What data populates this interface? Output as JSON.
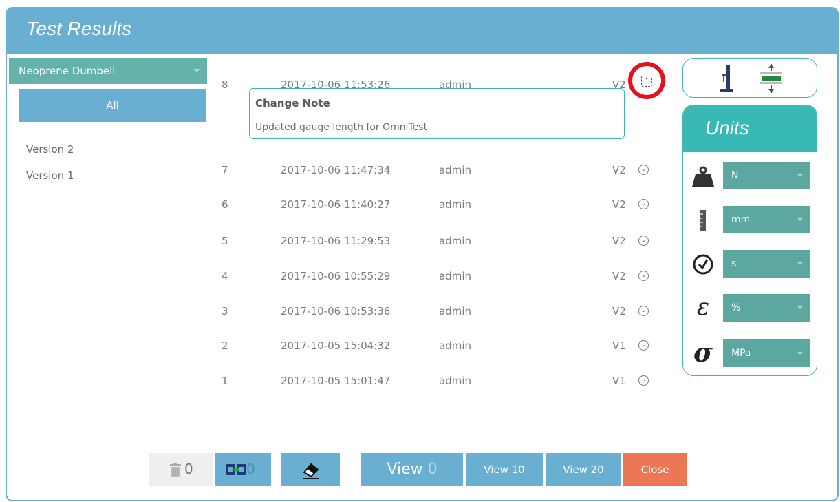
{
  "window": {
    "title": "Test Results"
  },
  "left_panel": {
    "dataset": "Neoprene Dumbell",
    "all_label": "All",
    "versions": [
      "Version 2",
      "Version 1"
    ]
  },
  "results": [
    {
      "num": "8",
      "date": "2017-10-06 11:53:26",
      "user": "admin",
      "version": "V2",
      "expanded": true
    },
    {
      "num": "7",
      "date": "2017-10-06 11:47:34",
      "user": "admin",
      "version": "V2"
    },
    {
      "num": "6",
      "date": "2017-10-06 11:40:27",
      "user": "admin",
      "version": "V2"
    },
    {
      "num": "5",
      "date": "2017-10-06 11:29:53",
      "user": "admin",
      "version": "V2"
    },
    {
      "num": "4",
      "date": "2017-10-06 10:55:29",
      "user": "admin",
      "version": "V2"
    },
    {
      "num": "3",
      "date": "2017-10-06 10:53:36",
      "user": "admin",
      "version": "V2"
    },
    {
      "num": "2",
      "date": "2017-10-05 15:04:32",
      "user": "admin",
      "version": "V1"
    },
    {
      "num": "1",
      "date": "2017-10-05 15:01:47",
      "user": "admin",
      "version": "V1"
    }
  ],
  "change_note": {
    "heading": "Change Note",
    "text": "Updated gauge length for OmniTest"
  },
  "units": {
    "title": "Units",
    "force": "N",
    "length": "mm",
    "time": "s",
    "strain": "%",
    "stress": "MPa",
    "strain_symbol": "ε",
    "stress_symbol": "σ"
  },
  "toolbar": {
    "delete_count": "0",
    "copy_count": "0",
    "view_label": "View",
    "view_count": "0",
    "view10_label": "View 10",
    "view20_label": "View 20",
    "close_label": "Close"
  },
  "colors": {
    "header": "#69afd2",
    "accent": "#39b9b6",
    "close": "#ec7754",
    "highlight": "#e8111b"
  }
}
